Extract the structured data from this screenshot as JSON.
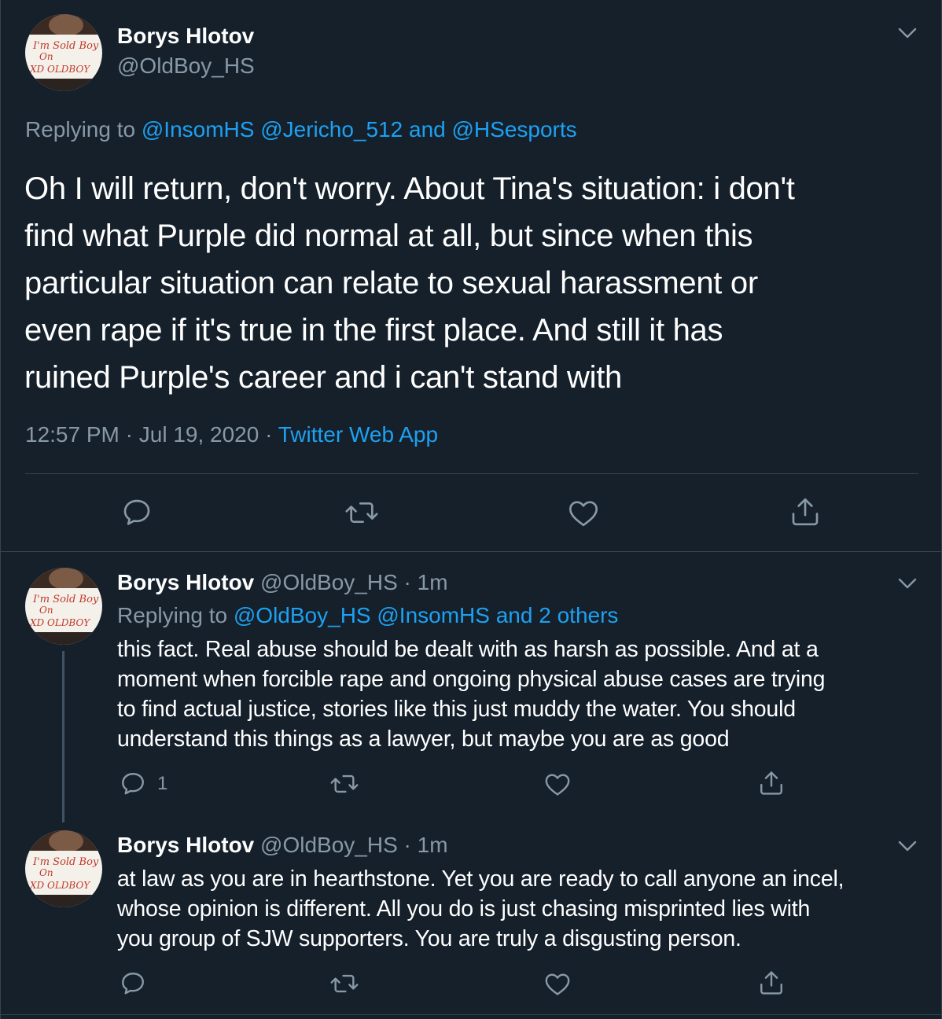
{
  "main_tweet": {
    "author_name": "Borys Hlotov",
    "author_handle": "@OldBoy_HS",
    "replying_prefix": "Replying to",
    "replying_1": "@InsomHS",
    "replying_2": "@Jericho_512",
    "replying_and": "and",
    "replying_3": "@HSesports",
    "text_lines": [
      "Oh I will return, don't worry. About Tina's situation: i don't",
      "find what Purple did normal at all, but since when this",
      "particular situation can relate to sexual harassment or",
      "even rape if it's true in the first place. And still it has",
      "ruined Purple's career and i can't stand with"
    ],
    "time": "12:57 PM",
    "dot": "·",
    "date": "Jul 19, 2020",
    "source": "Twitter Web App"
  },
  "reply1": {
    "author_name": "Borys Hlotov",
    "author_handle": "@OldBoy_HS",
    "dot": "·",
    "age": "1m",
    "replying_prefix": "Replying to",
    "replying_1": "@OldBoy_HS",
    "replying_2": "@InsomHS",
    "replying_and": "and",
    "replying_others": "2 others",
    "text_lines": [
      "this fact. Real abuse should be dealt with as harsh as possible. And at a",
      "moment when forcible rape and ongoing physical abuse cases are trying",
      "to find actual justice, stories like this just muddy the water. You should",
      "understand this things as a lawyer, but maybe you are as good"
    ],
    "reply_count": "1"
  },
  "reply2": {
    "author_name": "Borys Hlotov",
    "author_handle": "@OldBoy_HS",
    "dot": "·",
    "age": "1m",
    "text_lines": [
      "at law as you are in hearthstone. Yet you are ready to call anyone an incel,",
      "whose opinion is different. All you do is just chasing misprinted lies with",
      "you group of SJW supporters. You are truly a disgusting person."
    ]
  },
  "avatar": {
    "sign_line1": "I'm Sold Boy",
    "sign_line2": "On",
    "sign_line3": "XD OLDBOY"
  },
  "colors": {
    "background": "#15202b",
    "text": "#ffffff",
    "muted": "#8899a6",
    "link": "#1da1f2",
    "divider": "#38444d"
  },
  "icons": [
    "chevron-down-icon",
    "reply-icon",
    "retweet-icon",
    "like-icon",
    "share-icon"
  ]
}
